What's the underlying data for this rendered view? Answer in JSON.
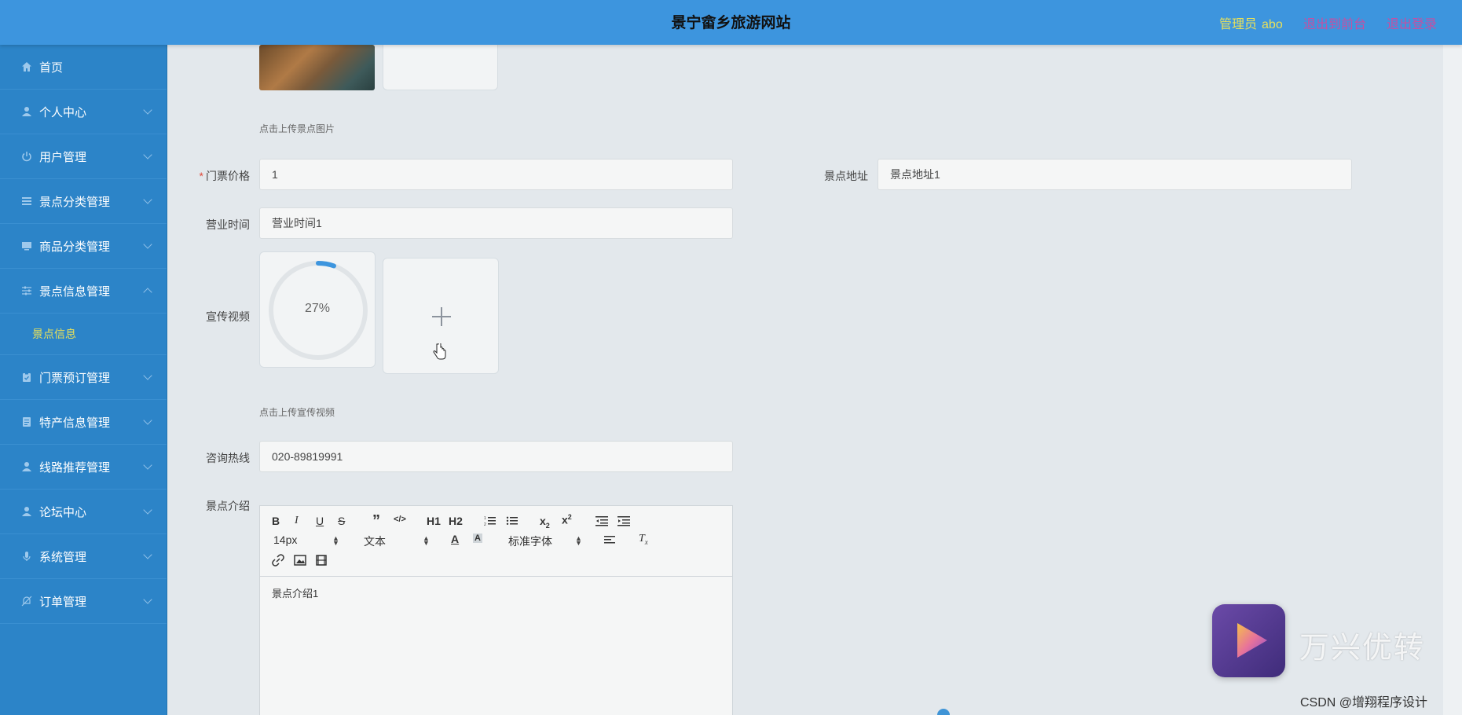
{
  "header": {
    "title": "景宁畲乡旅游网站",
    "admin_label": "管理员",
    "admin_user": "abo",
    "front_link": "退出到前台",
    "logout_link": "退出登录"
  },
  "sidebar": {
    "items": [
      {
        "label": "首页",
        "icon": "home-icon"
      },
      {
        "label": "个人中心",
        "icon": "user-icon"
      },
      {
        "label": "用户管理",
        "icon": "power-icon"
      },
      {
        "label": "景点分类管理",
        "icon": "list-icon"
      },
      {
        "label": "商品分类管理",
        "icon": "monitor-icon"
      },
      {
        "label": "景点信息管理",
        "icon": "sliders-icon",
        "expanded": true,
        "sub": [
          "景点信息"
        ]
      },
      {
        "label": "门票预订管理",
        "icon": "clipboard-icon"
      },
      {
        "label": "特产信息管理",
        "icon": "document-icon"
      },
      {
        "label": "线路推荐管理",
        "icon": "user-icon"
      },
      {
        "label": "论坛中心",
        "icon": "user-icon"
      },
      {
        "label": "系统管理",
        "icon": "microphone-icon"
      },
      {
        "label": "订单管理",
        "icon": "bell-off-icon"
      }
    ]
  },
  "form": {
    "image_hint": "点击上传景点图片",
    "price_label": "门票价格",
    "price_value": "1",
    "address_label": "景点地址",
    "address_value": "景点地址1",
    "hours_label": "营业时间",
    "hours_value": "营业时间1",
    "video_label": "宣传视频",
    "video_progress": "27%",
    "video_progress_value": 0.27,
    "video_hint": "点击上传宣传视频",
    "hotline_label": "咨询热线",
    "hotline_value": "020-89819991",
    "intro_label": "景点介绍",
    "intro_value": "景点介绍1"
  },
  "editor_toolbar": {
    "font_size": "14px",
    "block_type": "文本",
    "font_family": "标准字体",
    "h1": "H1",
    "h2": "H2"
  },
  "watermark": {
    "brand": "万兴优转",
    "credit": "CSDN @增翔程序设计"
  },
  "colors": {
    "header_bg": "#3d95de",
    "sidebar_bg": "#2c84c8",
    "active_sub": "#e8e05a",
    "link_pink": "#c74fa1",
    "required": "#e04a3a"
  }
}
